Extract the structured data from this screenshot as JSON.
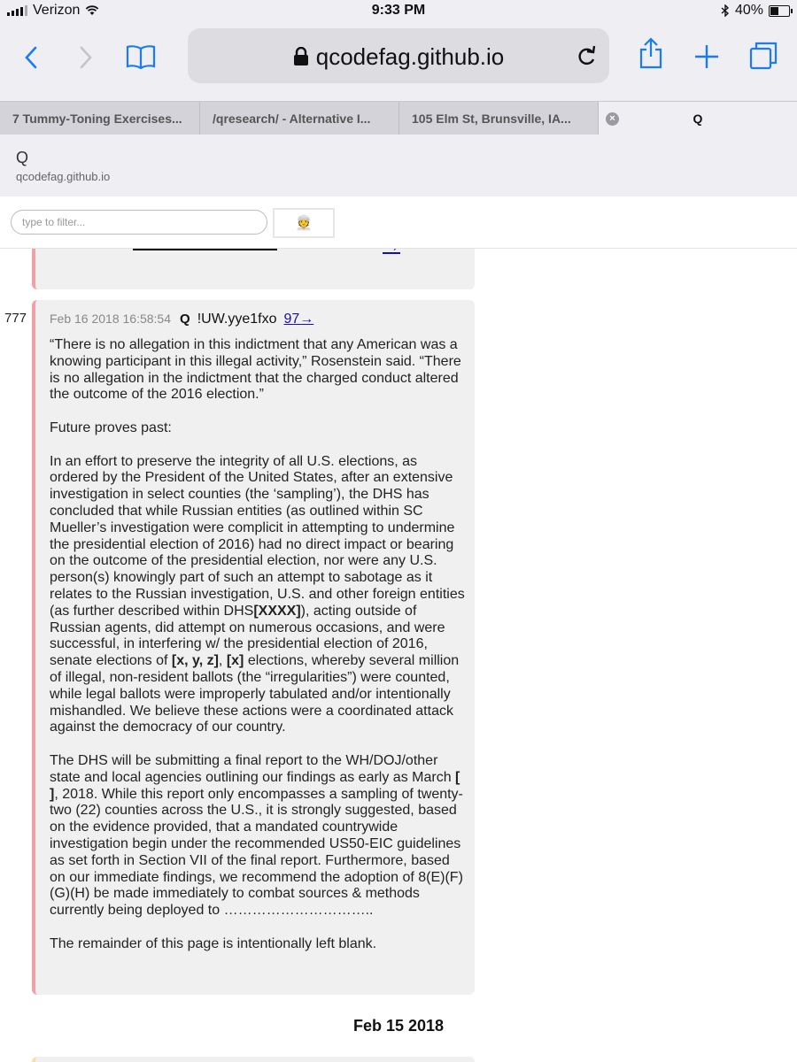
{
  "status": {
    "carrier": "Verizon",
    "time": "9:33 PM",
    "battery": "40%",
    "battery_level": 0.4
  },
  "browser": {
    "url": "qcodefag.github.io",
    "tabs": [
      {
        "label": "7 Tummy-Toning Exercises..."
      },
      {
        "label": "/qresearch/ - Alternative I..."
      },
      {
        "label": "105 Elm St, Brunsville, IA..."
      },
      {
        "label": "Q",
        "active": true
      }
    ]
  },
  "site": {
    "title": "Q",
    "host": "qcodefag.github.io"
  },
  "filter": {
    "placeholder": "type to filter...",
    "emoji": "👳"
  },
  "previous_post": {
    "link": "→"
  },
  "post": {
    "number": "777",
    "date": "Feb 16 2018 16:58:54",
    "author": "Q",
    "tripcode": "!UW.yye1fxo",
    "reply_link": "97→",
    "p1": "“There is no allegation in this indictment that any American was a knowing participant in this illegal activity,” Rosenstein said. “There is no allegation in the indictment that the charged conduct altered the outcome of the 2016 election.”",
    "p2": "Future proves past:",
    "p3a": "In an effort to preserve the integrity of all U.S. elections, as ordered by the President of the United States, after an extensive investigation in select counties (the ‘sampling’), the DHS has concluded that while Russian entities (as outlined within SC Mueller’s investigation were complicit in attempting to undermine the presidential election of 2016) had no direct impact or bearing on the outcome of the presidential election, nor were any U.S. person(s) knowingly part of such an attempt to sabotage as it relates to the Russian investigation, U.S. and other foreign entities (as further described within DHS",
    "p3b": "[XXXX]",
    "p3c": "), acting outside of Russian agents, did attempt on numerous occasions, and were successful, in interfering w/ the presidential election of 2016, senate elections of ",
    "p3d": "[x, y, z]",
    "p3e": ", ",
    "p3f": "[x]",
    "p3g": " elections, whereby several million of illegal, non-resident ballots (the “irregularities”) were counted, while legal ballots were improperly tabulated and/or intentionally mishandled. We believe these actions were a coordinated attack against the democracy of our country.",
    "p4a": "The DHS will be submitting a final report to the WH/DOJ/other state and local agencies outlining our findings as early as March ",
    "p4b": "[ ]",
    "p4c": ", 2018. While this report only encompasses a sampling of twenty-two (22) counties across the U.S., it is strongly suggested, based on the evidence provided, that a mandated countrywide investigation begin under the recommended US50-EIC guidelines as set forth in Section VII of the final report. Furthermore, based on our immediate findings, we recommend the adoption of 8(E)(F)(G)(H) be made immediately to combat sources & methods currently being deployed to …………………………..",
    "p5": "The remainder of this page is intentionally left blank."
  },
  "day_divider": "Feb 15 2018"
}
